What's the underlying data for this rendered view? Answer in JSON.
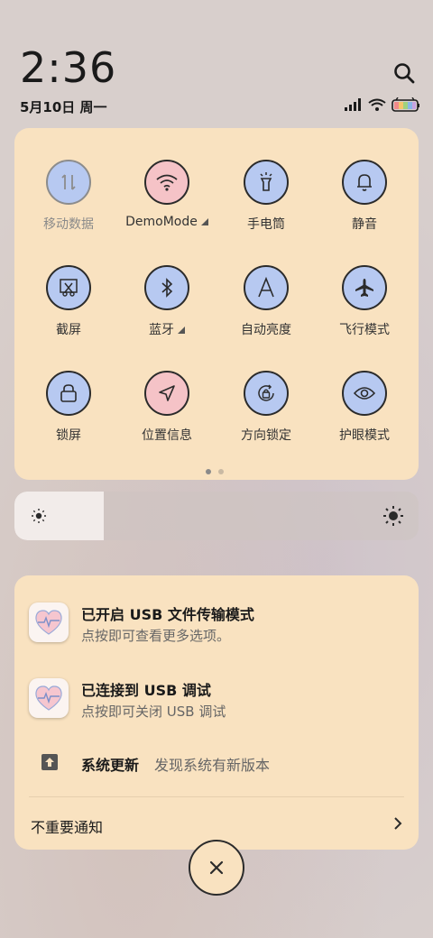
{
  "status": {
    "time": "2:36",
    "date": "5月10日 周一"
  },
  "tiles": [
    {
      "label": "移动数据",
      "icon": "mobile-data-icon",
      "color": "#b7c9f1",
      "dim": true
    },
    {
      "label": "DemoMode",
      "icon": "wifi-icon",
      "color": "#f5c3c7",
      "expand": true
    },
    {
      "label": "手电筒",
      "icon": "flashlight-icon",
      "color": "#b7c9f1"
    },
    {
      "label": "静音",
      "icon": "bell-icon",
      "color": "#b7c9f1"
    },
    {
      "label": "截屏",
      "icon": "screenshot-icon",
      "color": "#b7c9f1"
    },
    {
      "label": "蓝牙",
      "icon": "bluetooth-icon",
      "color": "#b7c9f1",
      "expand": true
    },
    {
      "label": "自动亮度",
      "icon": "auto-brightness-icon",
      "color": "#b7c9f1"
    },
    {
      "label": "飞行模式",
      "icon": "airplane-icon",
      "color": "#b7c9f1"
    },
    {
      "label": "锁屏",
      "icon": "lock-icon",
      "color": "#b7c9f1"
    },
    {
      "label": "位置信息",
      "icon": "location-icon",
      "color": "#f5c3c7"
    },
    {
      "label": "方向锁定",
      "icon": "rotation-lock-icon",
      "color": "#b7c9f1"
    },
    {
      "label": "护眼模式",
      "icon": "eye-icon",
      "color": "#b7c9f1"
    }
  ],
  "page_indicator": {
    "current": 1,
    "total": 2
  },
  "brightness": {
    "level": 0.22
  },
  "notifications": [
    {
      "title": "已开启 USB 文件传输模式",
      "subtitle": "点按即可查看更多选项。",
      "icon": "heart-app-icon"
    },
    {
      "title": "已连接到 USB 调试",
      "subtitle": "点按即可关闭 USB 调试",
      "icon": "heart-app-icon"
    }
  ],
  "update": {
    "title": "系统更新",
    "subtitle": "发现系统有新版本",
    "icon": "upload-icon"
  },
  "unimportant": {
    "label": "不重要通知"
  }
}
